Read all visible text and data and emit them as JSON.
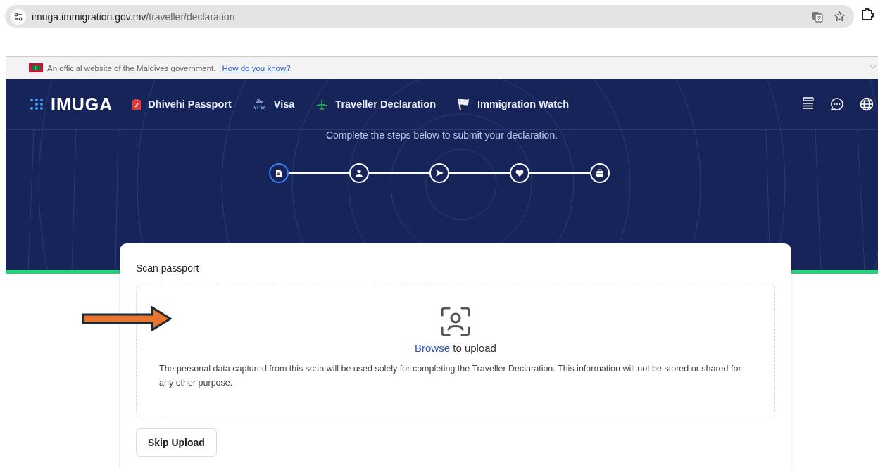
{
  "browser": {
    "url_host": "imuga.immigration.gov.mv",
    "url_path": "/traveller/declaration"
  },
  "gov_banner": {
    "text": "An official website of the Maldives government.",
    "link": "How do you know?"
  },
  "nav": {
    "logo": "IMUGA",
    "items": [
      {
        "label": "Dhivehi Passport",
        "kind": "passport"
      },
      {
        "label": "Visa",
        "kind": "visa"
      },
      {
        "label": "Traveller Declaration",
        "kind": "plane"
      },
      {
        "label": "Immigration Watch",
        "kind": "flag"
      }
    ]
  },
  "hero": {
    "subtitle": "Complete the steps below to submit your declaration.",
    "steps": [
      {
        "kind": "document",
        "selected": true
      },
      {
        "kind": "person",
        "selected": false
      },
      {
        "kind": "send",
        "selected": false
      },
      {
        "kind": "heart",
        "selected": false
      },
      {
        "kind": "luggage",
        "selected": false
      }
    ]
  },
  "card": {
    "title": "Scan passport",
    "upload_link": "Browse",
    "upload_rest": "to upload",
    "notice": "The personal data captured from this scan will be used solely for completing the Traveller Declaration. This information will not be stored or shared for any other purpose.",
    "skip_button": "Skip Upload"
  }
}
